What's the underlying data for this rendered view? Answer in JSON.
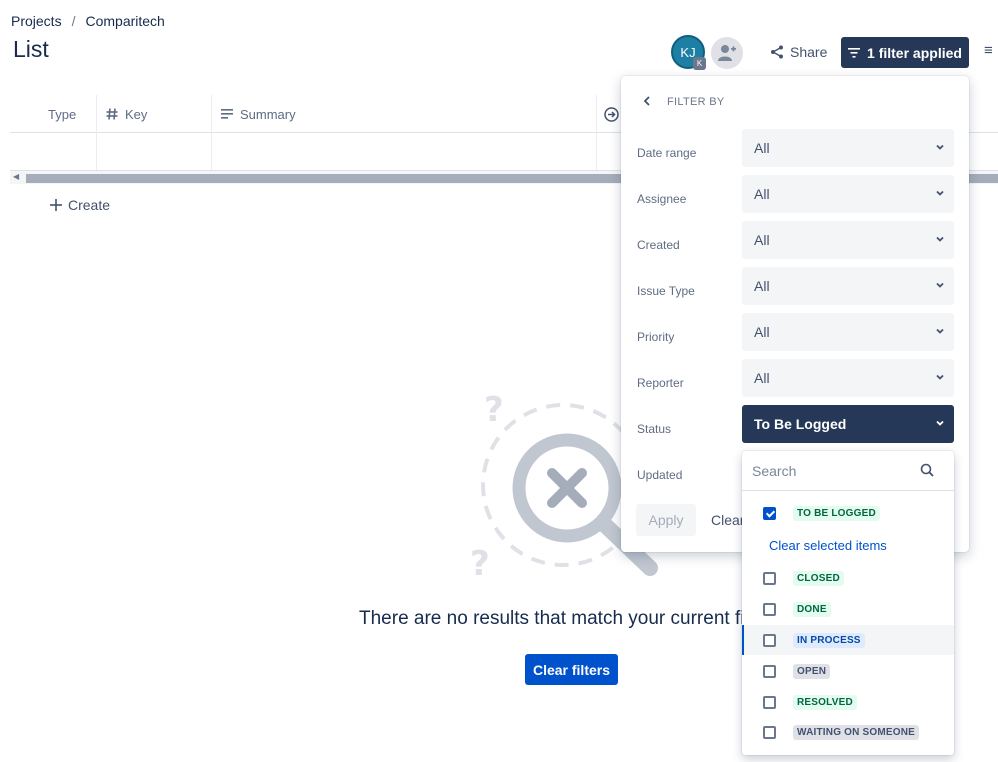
{
  "breadcrumb": {
    "root": "Projects",
    "separator": "/",
    "current": "Comparitech"
  },
  "page": {
    "title": "List"
  },
  "header": {
    "avatar_initials": "KJ",
    "avatar_badge": "K",
    "share_label": "Share",
    "filter_button_label": "1 filter applied",
    "more_label": "≡"
  },
  "table": {
    "columns": [
      {
        "label": "Type",
        "icon": ""
      },
      {
        "label": "Key",
        "icon": "hash-icon"
      },
      {
        "label": "Summary",
        "icon": "text-lines-icon"
      },
      {
        "label": "",
        "icon": "arrow-circle-icon"
      }
    ]
  },
  "create_label": "Create",
  "empty_state": {
    "message": "There are no results that match your current filters",
    "clear_button": "Clear filters"
  },
  "filter_panel": {
    "title": "FILTER BY",
    "filters": [
      {
        "label": "Date range",
        "value": "All"
      },
      {
        "label": "Assignee",
        "value": "All"
      },
      {
        "label": "Created",
        "value": "All"
      },
      {
        "label": "Issue Type",
        "value": "All"
      },
      {
        "label": "Priority",
        "value": "All"
      },
      {
        "label": "Reporter",
        "value": "All"
      },
      {
        "label": "Status",
        "value": "To Be Logged"
      },
      {
        "label": "Updated",
        "value": ""
      }
    ],
    "apply_label": "Apply",
    "clear_label": "Clear"
  },
  "status_dropdown": {
    "search_placeholder": "Search",
    "selected": [
      {
        "label": "TO BE LOGGED",
        "checked": true
      }
    ],
    "clear_selected_label": "Clear selected items",
    "options": [
      {
        "label": "CLOSED",
        "checked": false
      },
      {
        "label": "DONE",
        "checked": false
      },
      {
        "label": "IN PROCESS",
        "checked": false
      },
      {
        "label": "OPEN",
        "checked": false
      },
      {
        "label": "RESOLVED",
        "checked": false
      },
      {
        "label": "WAITING ON SOMEONE",
        "checked": false
      }
    ]
  },
  "colors": {
    "primary": "#0052cc",
    "dark": "#253858",
    "text": "#172b4d",
    "subtle": "#5e6c84"
  }
}
